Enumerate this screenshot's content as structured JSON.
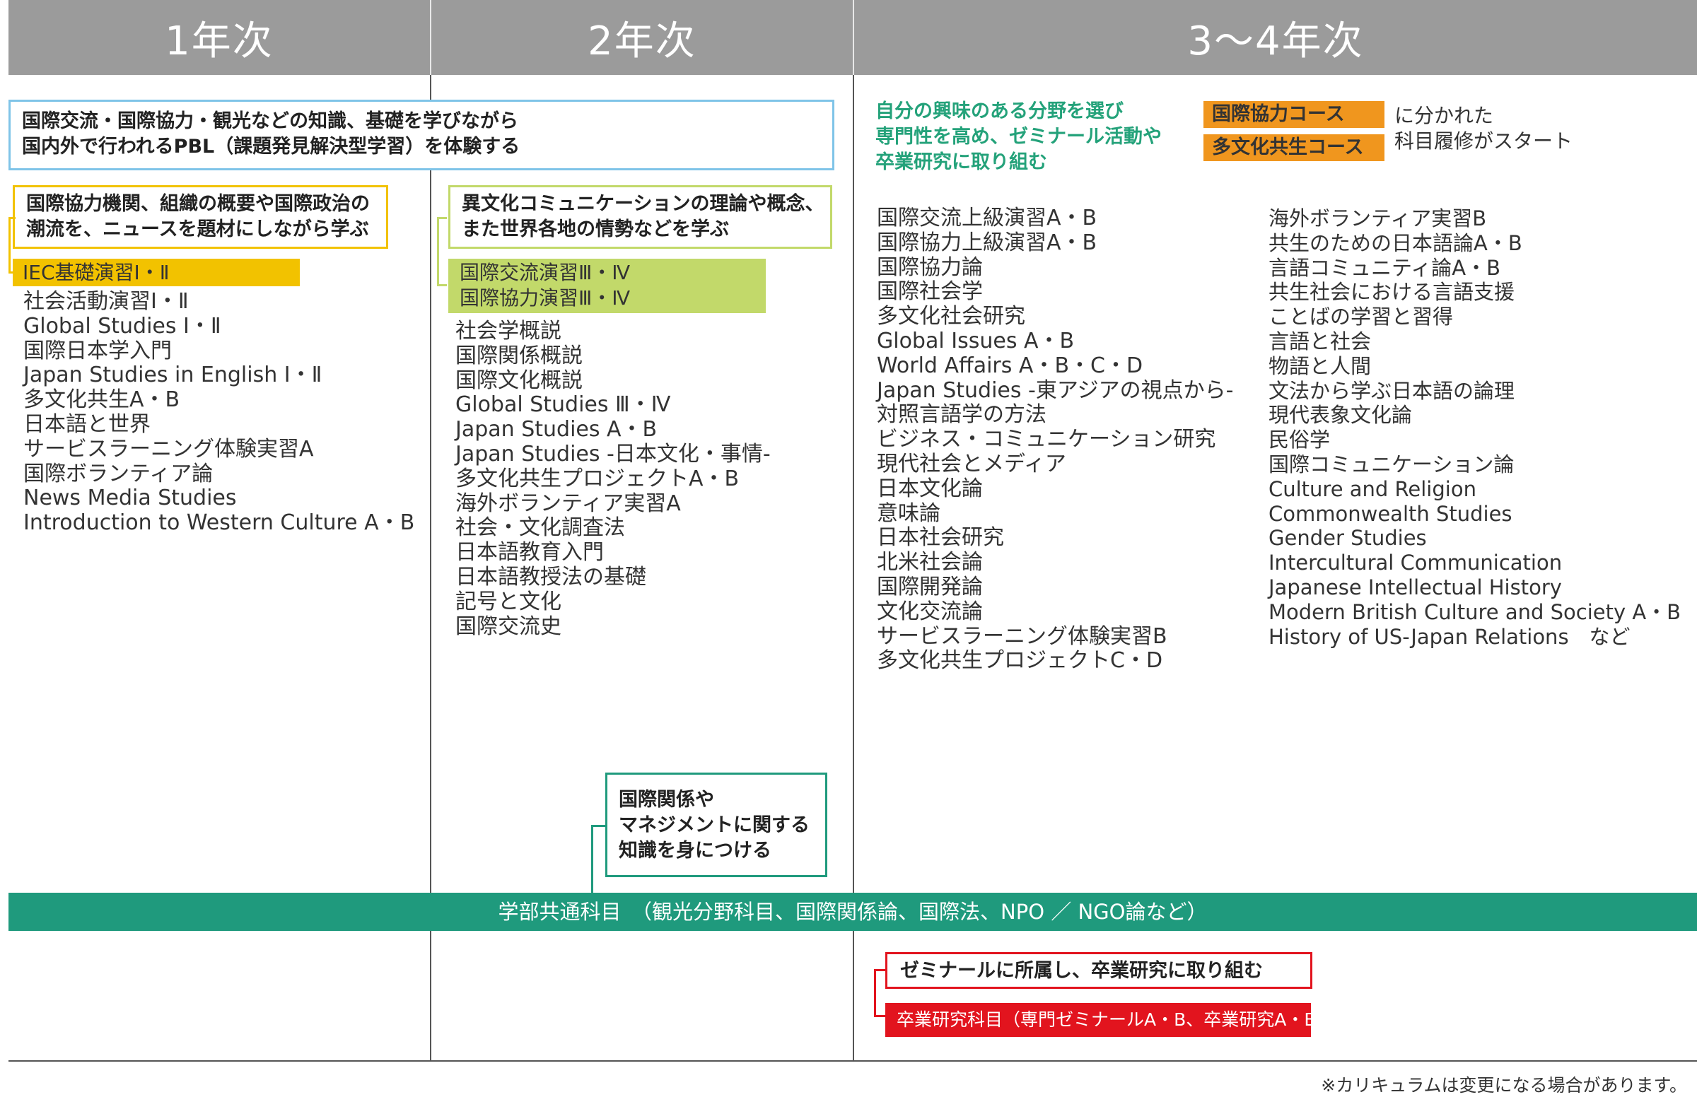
{
  "header": {
    "year1": "1年次",
    "year2": "2年次",
    "year34": "3～4年次"
  },
  "colors": {
    "header_bg": "#9b9b9b",
    "blue_border": "#7fc4e8",
    "yellow": "#f2c200",
    "green_light": "#c2d96a",
    "teal": "#1f9a7d",
    "orange": "#f0961e",
    "red": "#e2141e",
    "green_text": "#24a27a"
  },
  "intro": {
    "line1": "国際交流・国際協力・観光などの知識、基礎を学びながら",
    "line2": "国内外で行われるPBL（課題発見解決型学習）を体験する"
  },
  "year1": {
    "callout_line1": "国際協力機関、組織の概要や国際政治の",
    "callout_line2": "潮流を、ニュースを題材にしながら学ぶ",
    "highlight": "IEC基礎演習Ⅰ・Ⅱ",
    "courses": [
      "社会活動演習Ⅰ・Ⅱ",
      "Global Studies Ⅰ・Ⅱ",
      "国際日本学入門",
      "Japan Studies in English Ⅰ・Ⅱ",
      "多文化共生A・B",
      "日本語と世界",
      "サービスラーニング体験実習A",
      "国際ボランティア論",
      "News Media Studies",
      "Introduction to Western Culture A・B"
    ]
  },
  "year2": {
    "callout_line1": "異文化コミュニケーションの理論や概念、",
    "callout_line2": "また世界各地の情勢などを学ぶ",
    "highlight1": "国際交流演習Ⅲ・Ⅳ",
    "highlight2": "国際協力演習Ⅲ・Ⅳ",
    "courses": [
      "社会学概説",
      "国際関係概説",
      "国際文化概説",
      "Global Studies Ⅲ・Ⅳ",
      "Japan Studies A・B",
      "Japan Studies -日本文化・事情-",
      "多文化共生プロジェクトA・B",
      "海外ボランティア実習A",
      "社会・文化調査法",
      "日本語教育入門",
      "日本語教授法の基礎",
      "記号と文化",
      "国際交流史"
    ],
    "mgmt_line1": "国際関係や",
    "mgmt_line2": "マネジメントに関する",
    "mgmt_line3": "知識を身につける"
  },
  "year34": {
    "intro_line1": "自分の興味のある分野を選び",
    "intro_line2": "専門性を高め、ゼミナール活動や",
    "intro_line3": "卒業研究に取り組む",
    "course_tag1": "国際協力コース",
    "course_tag2": "多文化共生コース",
    "split_line1": "に分かれた",
    "split_line2": "科目履修がスタート",
    "courses_left": [
      "国際交流上級演習A・B",
      "国際協力上級演習A・B",
      "国際協力論",
      "国際社会学",
      "多文化社会研究",
      "Global Issues A・B",
      "World Affairs A・B・C・D",
      "Japan Studies -東アジアの視点から-",
      "対照言語学の方法",
      "ビジネス・コミュニケーション研究",
      "現代社会とメディア",
      "日本文化論",
      "意味論",
      "日本社会研究",
      "北米社会論",
      "国際開発論",
      "文化交流論",
      "サービスラーニング体験実習B",
      "多文化共生プロジェクトC・D"
    ],
    "courses_right": [
      "海外ボランティア実習B",
      "共生のための日本語論A・B",
      "言語コミュニティ論A・B",
      "共生社会における言語支援",
      "ことばの学習と習得",
      "言語と社会",
      "物語と人間",
      "文法から学ぶ日本語の論理",
      "現代表象文化論",
      "民俗学",
      "国際コミュニケーション論",
      "Culture and Religion",
      "Commonwealth Studies",
      "Gender Studies",
      "Intercultural Communication",
      "Japanese Intellectual History",
      "Modern British Culture and Society A・B",
      "History of US-Japan Relations　など"
    ],
    "seminar_text": "ゼミナールに所属し、卒業研究に取り組む",
    "seminar_subjects": "卒業研究科目（専門ゼミナールA・B、卒業研究A・B）"
  },
  "common_bar": "学部共通科目　（観光分野科目、国際関係論、国際法、NPO ／ NGO論など）",
  "footnote": "※カリキュラムは変更になる場合があります。"
}
